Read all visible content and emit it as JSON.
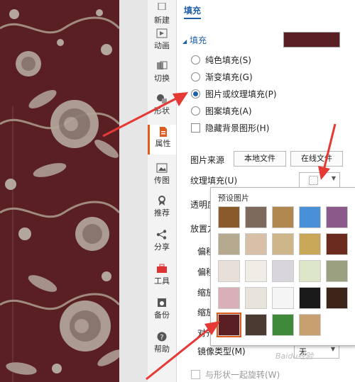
{
  "rail": {
    "items": [
      {
        "label": "新建",
        "icon": "new-icon"
      },
      {
        "label": "动画",
        "icon": "animation-icon"
      },
      {
        "label": "切换",
        "icon": "switch-icon"
      },
      {
        "label": "形状",
        "icon": "shape-icon"
      },
      {
        "label": "属性",
        "icon": "property-icon"
      },
      {
        "label": "传图",
        "icon": "upload-image-icon"
      },
      {
        "label": "推荐",
        "icon": "recommend-icon"
      },
      {
        "label": "分享",
        "icon": "share-icon"
      },
      {
        "label": "工具",
        "icon": "toolbox-icon"
      },
      {
        "label": "备份",
        "icon": "backup-icon"
      },
      {
        "label": "帮助",
        "icon": "help-icon"
      }
    ]
  },
  "panel": {
    "tab": "填充",
    "section_title": "填充",
    "fill_options": [
      {
        "label": "纯色填充(S)",
        "selected": false
      },
      {
        "label": "渐变填充(G)",
        "selected": false
      },
      {
        "label": "图片或纹理填充(P)",
        "selected": true
      },
      {
        "label": "图案填充(A)",
        "selected": false
      }
    ],
    "hide_bg_label": "隐藏背景图形(H)",
    "image_source_label": "图片来源",
    "local_file_btn": "本地文件",
    "online_file_btn": "在线文件",
    "texture_fill_label": "纹理填充(U)",
    "transparency_label": "透明度",
    "placement_label": "放置方",
    "offset_x_label": "偏移",
    "offset_y_label": "偏移",
    "scale_x_label": "缩放",
    "scale_y_label": "缩放",
    "align_label": "对齐",
    "mirror_label": "镜像类型(M)",
    "mirror_value": "无",
    "rotate_label": "与形状一起旋转(W)"
  },
  "popup": {
    "title": "预设图片"
  },
  "colors": {
    "slide_bg": "#5a1f22",
    "pattern": "#b3a69a",
    "accent": "#1f5fa8",
    "arrow": "#e53935",
    "rail_active": "#e05a1a"
  }
}
